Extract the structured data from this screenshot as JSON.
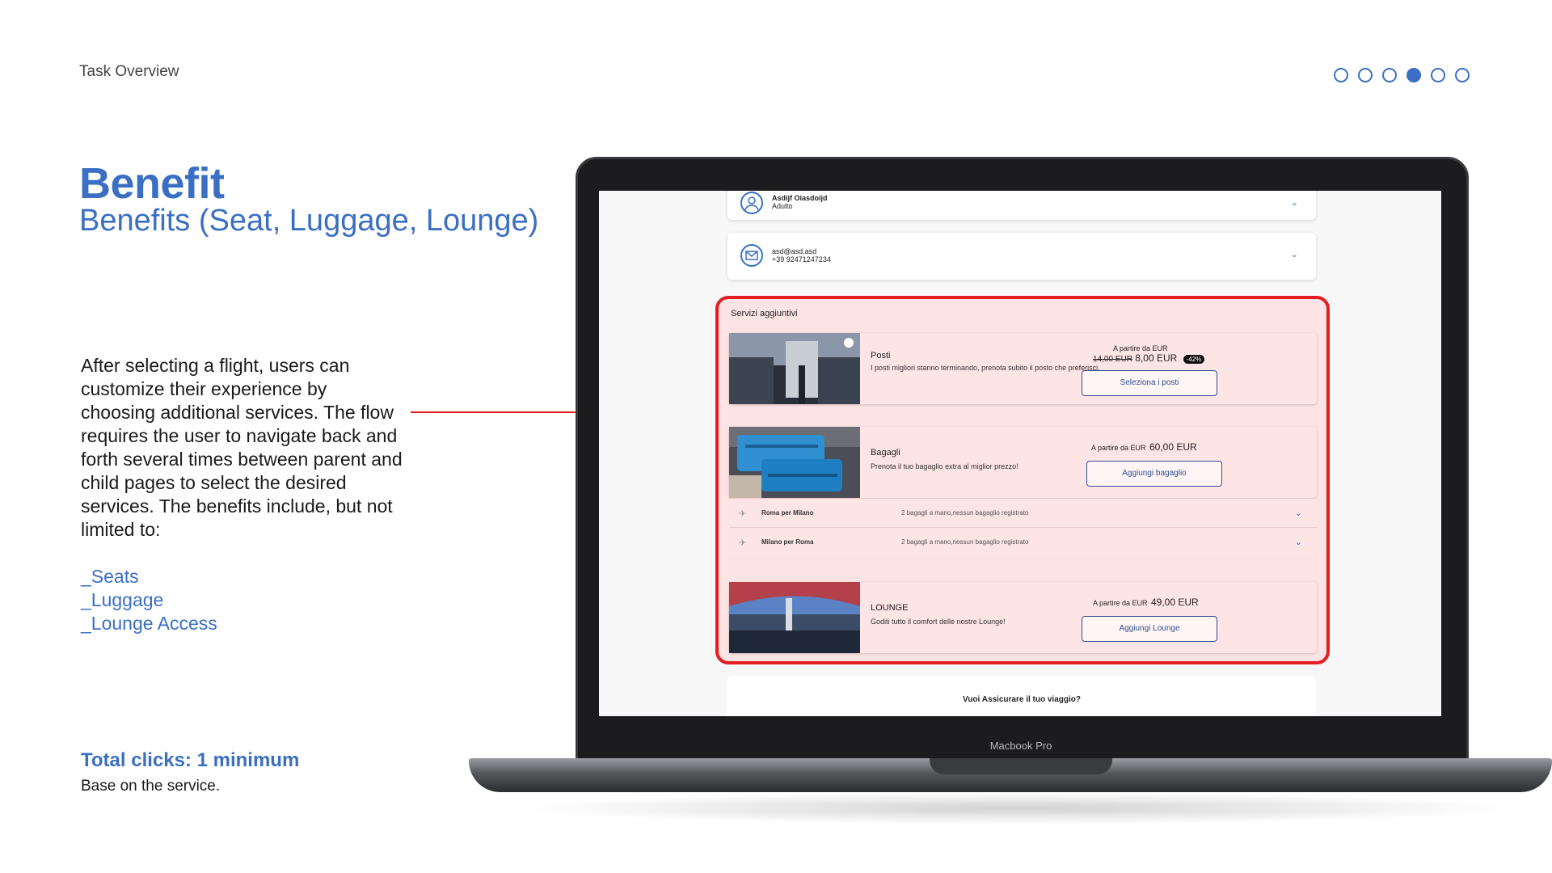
{
  "header": {
    "label": "Task Overview"
  },
  "pager": {
    "total": 6,
    "active_index": 3
  },
  "title": "Benefit",
  "subtitle": "Benefits (Seat, Luggage, Lounge)",
  "description": "After selecting a flight, users can customize their experience by choosing additional services. The flow requires the user to navigate back and forth several times between parent and child pages to select the desired services. The benefits include, but not limited to:",
  "benefits": [
    "_Seats",
    "_Luggage",
    "_Lounge Access"
  ],
  "clicks": {
    "title": "Total clicks: 1 minimum",
    "note": "Base on the service."
  },
  "laptop": {
    "brand": "Macbook Pro"
  },
  "screen": {
    "passenger": {
      "name": "Asdijf Oiasdoijd",
      "type": "Adulto"
    },
    "contact": {
      "email": "asd@asd.asd",
      "phone": "+39 92471247234"
    },
    "services_title": "Servizi aggiuntivi",
    "seats": {
      "name": "Posti",
      "desc": "I posti migliori stanno terminando, prenota subito il posto che preferisci.",
      "from": "A partire da EUR",
      "old_price": "14,00 EUR",
      "price": "8,00 EUR",
      "discount": "-42%",
      "button": "Seleziona i posti"
    },
    "bags": {
      "name": "Bagagli",
      "desc": "Prenota il tuo bagaglio extra al miglior prezzo!",
      "from": "A partire da EUR",
      "price": "60,00 EUR",
      "button": "Aggiungi bagaglio",
      "routes": [
        {
          "name": "Roma per Milano",
          "desc": "2 bagagli a mano,nessun bagaglio registrato"
        },
        {
          "name": "Milano per Roma",
          "desc": "2 bagagli a mano,nessun bagaglio registrato"
        }
      ]
    },
    "lounge": {
      "name": "LOUNGE",
      "desc": "Goditi tutto il comfort delle nostre Lounge!",
      "from": "A partire da EUR",
      "price": "49,00 EUR",
      "button": "Aggiungi Lounge"
    },
    "insurance": "Vuoi Assicurare il tuo viaggio?"
  },
  "colors": {
    "accent": "#3a6fc4",
    "highlight": "#e41d23",
    "highlight_bg": "#fce3e4"
  },
  "icons": [
    "user-icon",
    "mail-icon",
    "chevron-down-icon",
    "plane-icon",
    "arrow-right-icon"
  ]
}
